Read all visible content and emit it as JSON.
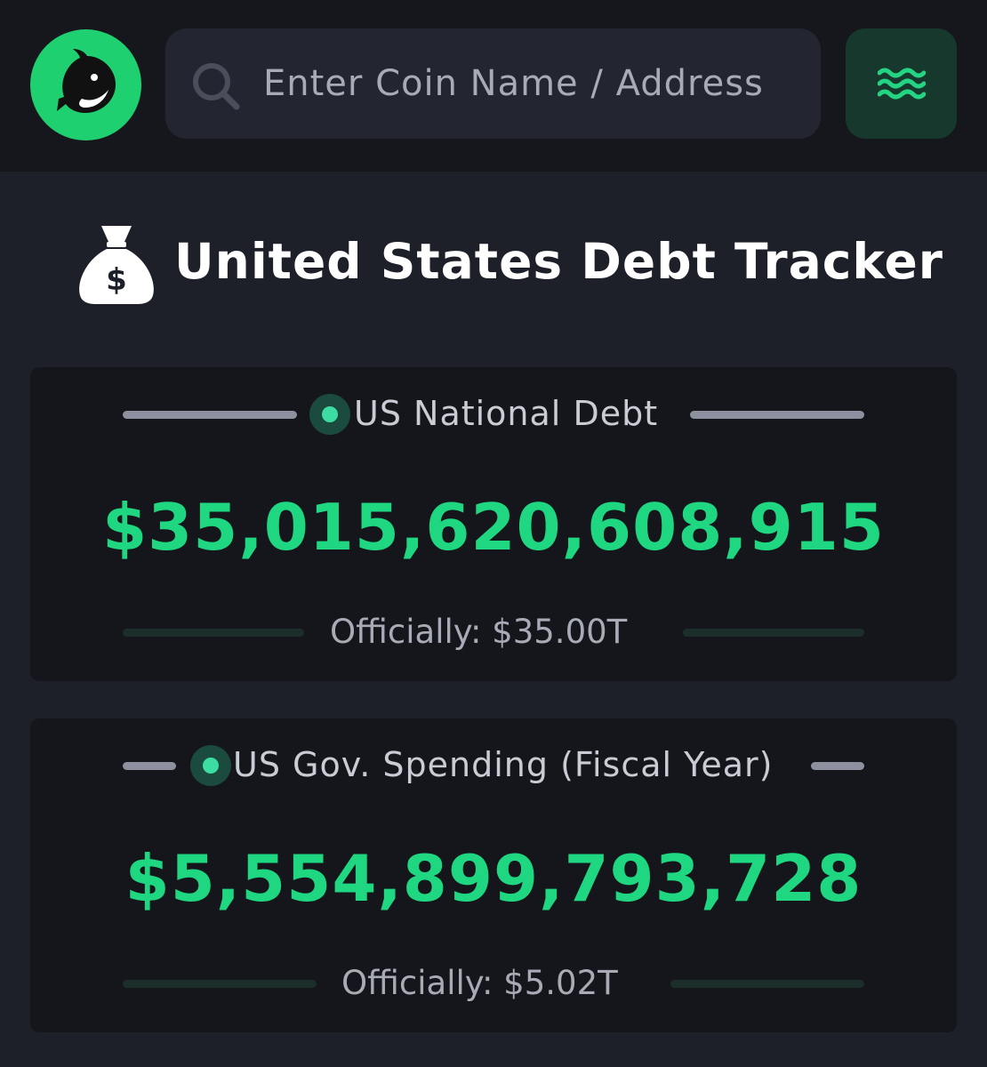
{
  "header": {
    "search_placeholder": "Enter Coin Name / Address",
    "logo_icon": "whale-logo-icon",
    "menu_icon": "waves-menu-icon",
    "accent_color": "#1ed06f"
  },
  "page": {
    "title": "United States Debt Tracker",
    "title_icon": "money-bag-icon"
  },
  "cards": [
    {
      "label": "US National Debt",
      "amount": "$35,015,620,608,915",
      "official": "Officially: $35.00T"
    },
    {
      "label": "US Gov. Spending (Fiscal Year)",
      "amount": "$5,554,899,793,728",
      "official": "Officially: $5.02T"
    }
  ]
}
